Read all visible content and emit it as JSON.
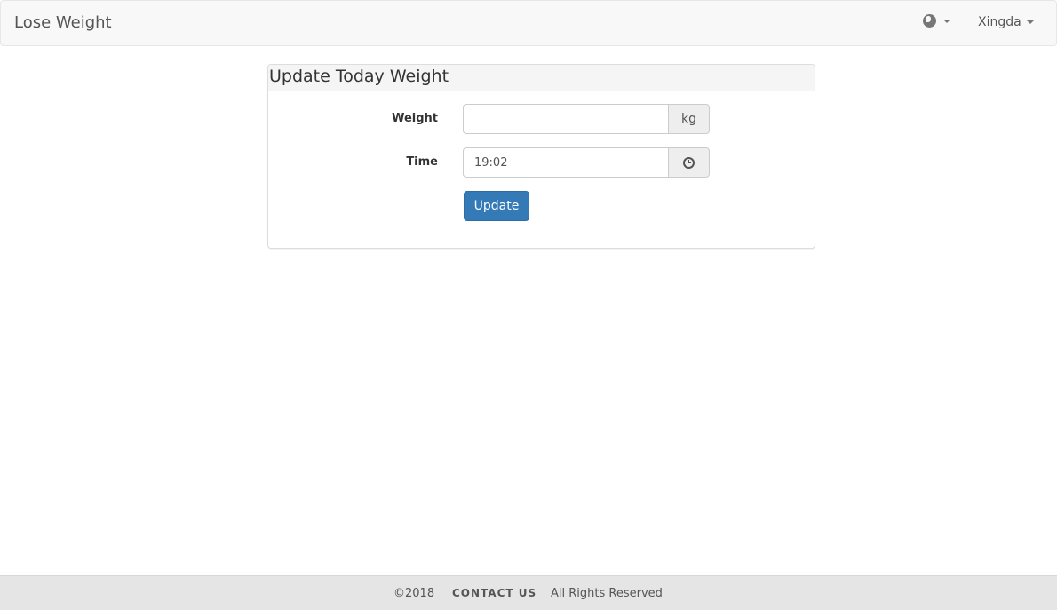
{
  "navbar": {
    "brand": "Lose Weight",
    "language_icon": "globe-icon",
    "user_name": "Xingda"
  },
  "panel": {
    "title": "Update Today Weight",
    "weight": {
      "label": "Weight",
      "value": "",
      "addon": "kg"
    },
    "time": {
      "label": "Time",
      "value": "19:02",
      "addon_icon": "clock-icon"
    },
    "submit_label": "Update"
  },
  "footer": {
    "copyright": "©2018",
    "contact": "CONTACT US",
    "rights": "All Rights Reserved"
  },
  "colors": {
    "primary": "#337ab7",
    "navbar_bg": "#f8f8f8",
    "footer_bg": "#e5e5e5"
  }
}
